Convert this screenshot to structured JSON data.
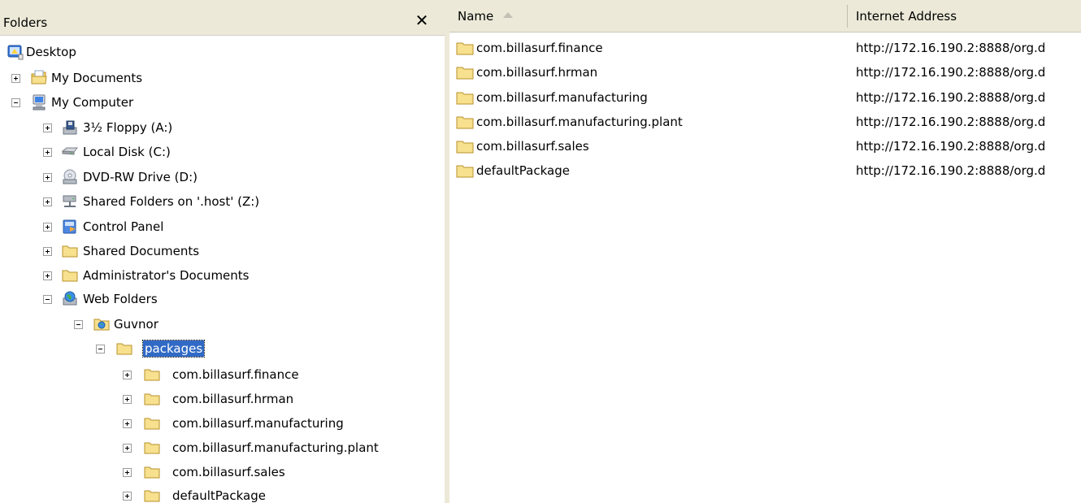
{
  "folders_pane": {
    "title": "Folders",
    "close_glyph": "✕"
  },
  "tree": {
    "desktop": "Desktop",
    "my_documents": "My Documents",
    "my_computer": "My Computer",
    "floppy": "3½ Floppy (A:)",
    "local_disk": "Local Disk (C:)",
    "dvd": "DVD-RW Drive (D:)",
    "shared_host": "Shared Folders on '.host' (Z:)",
    "control_panel": "Control Panel",
    "shared_documents": "Shared Documents",
    "admin_documents": "Administrator's Documents",
    "web_folders": "Web Folders",
    "guvnor": "Guvnor",
    "packages": "packages",
    "pkg_finance": "com.billasurf.finance",
    "pkg_hrman": "com.billasurf.hrman",
    "pkg_manufacturing": "com.billasurf.manufacturing",
    "pkg_manufacturing_plant": "com.billasurf.manufacturing.plant",
    "pkg_sales": "com.billasurf.sales",
    "pkg_default": "defaultPackage"
  },
  "list": {
    "columns": [
      "Name",
      "Internet Address"
    ],
    "rows": [
      {
        "name": "com.billasurf.finance",
        "address": "http://172.16.190.2:8888/org.d"
      },
      {
        "name": "com.billasurf.hrman",
        "address": "http://172.16.190.2:8888/org.d"
      },
      {
        "name": "com.billasurf.manufacturing",
        "address": "http://172.16.190.2:8888/org.d"
      },
      {
        "name": "com.billasurf.manufacturing.plant",
        "address": "http://172.16.190.2:8888/org.d"
      },
      {
        "name": "com.billasurf.sales",
        "address": "http://172.16.190.2:8888/org.d"
      },
      {
        "name": "defaultPackage",
        "address": "http://172.16.190.2:8888/org.d"
      }
    ]
  },
  "icons": {
    "desktop": "desktop-icon",
    "my_documents": "my-documents-icon",
    "my_computer": "my-computer-icon",
    "floppy": "floppy-drive-icon",
    "local_disk": "hard-disk-icon",
    "dvd": "dvd-drive-icon",
    "shared_host": "network-drive-icon",
    "control_panel": "control-panel-icon",
    "folder": "folder-icon",
    "web_folders": "web-folders-icon",
    "guvnor": "web-folder-icon",
    "sort": "sort-ascending-icon"
  },
  "colors": {
    "selection": "#316ac5",
    "header_bg": "#ece9d8",
    "folder_fill": "#f7e08e"
  }
}
